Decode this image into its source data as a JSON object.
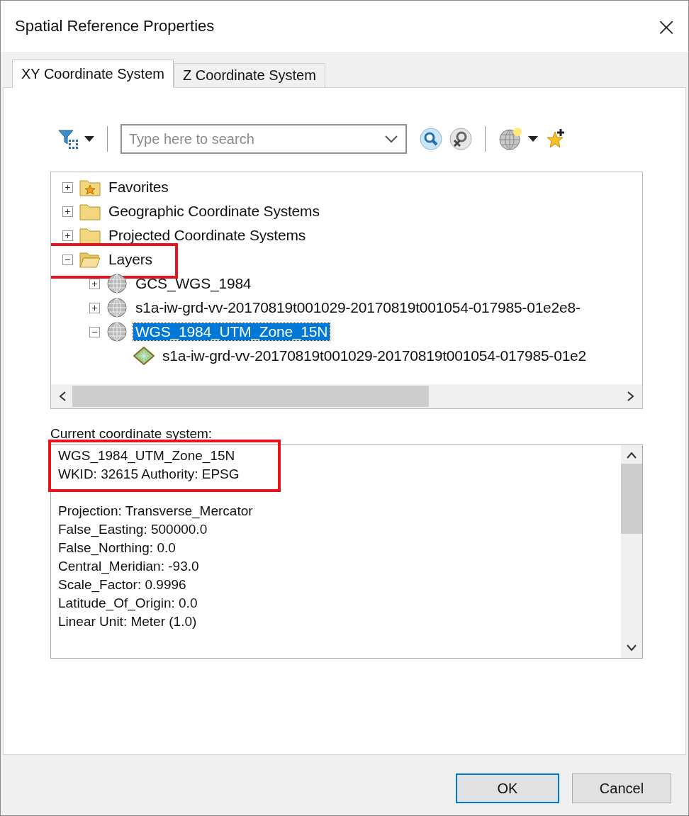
{
  "window": {
    "title": "Spatial Reference Properties",
    "close": "×"
  },
  "tabs": [
    {
      "label": "XY Coordinate System",
      "selected": true
    },
    {
      "label": "Z Coordinate System",
      "selected": false
    }
  ],
  "search": {
    "placeholder": "Type here to search"
  },
  "tree": [
    {
      "label": "Favorites",
      "kind": "favorites",
      "expanded": false,
      "selected": false
    },
    {
      "label": "Geographic Coordinate Systems",
      "kind": "folder",
      "expanded": false,
      "selected": false
    },
    {
      "label": "Projected Coordinate Systems",
      "kind": "folder",
      "expanded": false,
      "selected": false
    },
    {
      "label": "Layers",
      "kind": "folder",
      "expanded": true,
      "selected": false,
      "highlighted": true,
      "children": [
        {
          "label": "GCS_WGS_1984",
          "kind": "globe",
          "expanded": false,
          "selected": false
        },
        {
          "label": "s1a-iw-grd-vv-20170819t001029-20170819t001054-017985-01e2e8-",
          "kind": "globe",
          "expanded": false,
          "selected": false
        },
        {
          "label": "WGS_1984_UTM_Zone_15N",
          "kind": "globe",
          "expanded": true,
          "selected": true,
          "children": [
            {
              "label": "s1a-iw-grd-vv-20170819t001029-20170819t001054-017985-01e2",
              "kind": "raster",
              "selected": false
            }
          ]
        }
      ]
    }
  ],
  "current": {
    "label": "Current coordinate system:",
    "header": {
      "highlighted": true,
      "lines": [
        "WGS_1984_UTM_Zone_15N",
        "WKID: 32615 Authority: EPSG"
      ]
    },
    "lines": [
      "Projection: Transverse_Mercator",
      "False_Easting: 500000.0",
      "False_Northing: 0.0",
      "Central_Meridian: -93.0",
      "Scale_Factor: 0.9996",
      "Latitude_Of_Origin: 0.0",
      "Linear Unit: Meter (1.0)"
    ]
  },
  "buttons": [
    {
      "label": "OK",
      "default": true
    },
    {
      "label": "Cancel",
      "default": false
    }
  ]
}
